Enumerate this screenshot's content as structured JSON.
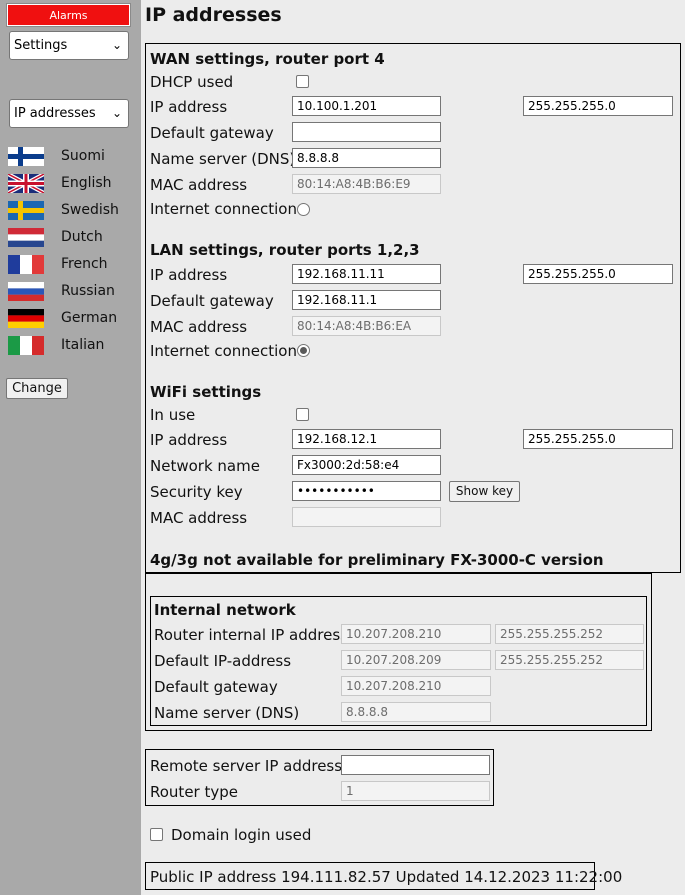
{
  "sidebar": {
    "alarms_label": "Alarms",
    "menu_select": "Settings",
    "page_select": "IP addresses",
    "languages": [
      {
        "label": "Suomi",
        "flag": "finland-flag-icon"
      },
      {
        "label": "English",
        "flag": "uk-flag-icon"
      },
      {
        "label": "Swedish",
        "flag": "sweden-flag-icon"
      },
      {
        "label": "Dutch",
        "flag": "netherlands-flag-icon"
      },
      {
        "label": "French",
        "flag": "france-flag-icon"
      },
      {
        "label": "Russian",
        "flag": "russia-flag-icon"
      },
      {
        "label": "German",
        "flag": "germany-flag-icon"
      },
      {
        "label": "Italian",
        "flag": "italy-flag-icon"
      }
    ],
    "change_label": "Change"
  },
  "page": {
    "title": "IP addresses"
  },
  "wan": {
    "title": "WAN settings, router port 4",
    "dhcp_label": "DHCP used",
    "dhcp_checked": false,
    "ip_label": "IP address",
    "ip": "10.100.1.201",
    "mask": "255.255.255.0",
    "gateway_label": "Default gateway",
    "gateway": "",
    "dns_label": "Name server (DNS)",
    "dns": "8.8.8.8",
    "mac_label": "MAC address",
    "mac": "80:14:A8:4B:B6:E9",
    "internet_label": "Internet connection",
    "internet_selected": false
  },
  "lan": {
    "title": "LAN settings, router ports 1,2,3",
    "ip_label": "IP address",
    "ip": "192.168.11.11",
    "mask": "255.255.255.0",
    "gateway_label": "Default gateway",
    "gateway": "192.168.11.1",
    "mac_label": "MAC address",
    "mac": "80:14:A8:4B:B6:EA",
    "internet_label": "Internet connection",
    "internet_selected": true
  },
  "wifi": {
    "title": "WiFi settings",
    "inuse_label": "In use",
    "inuse_checked": false,
    "ip_label": "IP address",
    "ip": "192.168.12.1",
    "mask": "255.255.255.0",
    "name_label": "Network name",
    "name": "Fx3000:2d:58:e4",
    "key_label": "Security key",
    "key": "•••••••••••",
    "show_key_label": "Show key",
    "mac_label": "MAC address",
    "mac": ""
  },
  "cellular_note": "4g/3g not available for preliminary FX-3000-C version",
  "internal": {
    "title": "Internal network",
    "router_ip_label": "Router internal IP address",
    "router_ip": "10.207.208.210",
    "router_mask": "255.255.255.252",
    "default_ip_label": "Default IP-address",
    "default_ip": "10.207.208.209",
    "default_mask": "255.255.255.252",
    "gateway_label": "Default gateway",
    "gateway": "10.207.208.210",
    "dns_label": "Name server (DNS)",
    "dns": "8.8.8.8"
  },
  "remote": {
    "server_label": "Remote server IP address:",
    "server": "",
    "router_type_label": "Router type",
    "router_type": "1"
  },
  "domain_login_label": "Domain login used",
  "domain_login_checked": false,
  "public_ip": "Public IP address 194.111.82.57 Updated 14.12.2023 11:22:00",
  "colors": {
    "sidebar_bg": "#a9a9a9",
    "page_bg": "#ececec",
    "alarm": "#f01010"
  }
}
